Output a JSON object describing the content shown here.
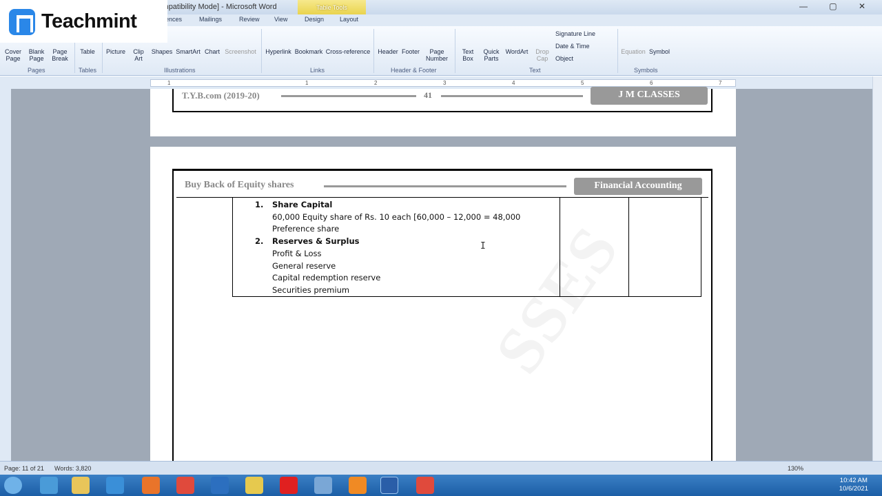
{
  "window": {
    "title": "chapter 3 buy back [Compatibility Mode] - Microsoft Word",
    "table_tools": "Table Tools",
    "controls": "—  ▢  ✕"
  },
  "tabs": [
    "ences",
    "Mailings",
    "Review",
    "View",
    "Design",
    "Layout"
  ],
  "ribbon": {
    "buttons": [
      "Cover Page",
      "Blank Page",
      "Page Break",
      "Table",
      "Picture",
      "Clip Art",
      "Shapes",
      "SmartArt",
      "Chart",
      "Screenshot",
      "Hyperlink",
      "Bookmark",
      "Cross-reference",
      "Header",
      "Footer",
      "Page Number",
      "Text Box",
      "Quick Parts",
      "WordArt",
      "Drop Cap",
      "Equation",
      "Symbol"
    ],
    "small": [
      "Signature Line",
      "Date & Time",
      "Object"
    ],
    "groups": [
      "Pages",
      "Tables",
      "Illustrations",
      "Links",
      "Header & Footer",
      "Text",
      "Symbols"
    ]
  },
  "ruler_numbers": [
    "1",
    "1",
    "2",
    "3",
    "4",
    "5",
    "6",
    "7"
  ],
  "page1": {
    "course": "T.Y.B.com (2019-20)",
    "page_number": "41",
    "brand": "J M CLASSES"
  },
  "page2": {
    "header": "Buy Back of Equity shares",
    "subject": "Financial Accounting",
    "lines": [
      {
        "num": "1.",
        "text": "Share Capital"
      },
      {
        "text": "60,000 Equity share of Rs. 10 each [60,000 – 12,000 = 48,000"
      },
      {
        "text": "Preference share"
      },
      {
        "num": "2.",
        "text": "Reserves & Surplus"
      },
      {
        "text": "Profit & Loss"
      },
      {
        "text": "General reserve"
      },
      {
        "text": "Capital redemption reserve"
      },
      {
        "text": "Securities premium"
      }
    ],
    "watermark": "SSES"
  },
  "status": {
    "page": "Page: 11 of 21",
    "words": "Words: 3,820",
    "zoom": "130%"
  },
  "clock": {
    "time": "10:42 AM",
    "date": "10/6/2021"
  },
  "overlay": {
    "brand": "Teachmint"
  }
}
